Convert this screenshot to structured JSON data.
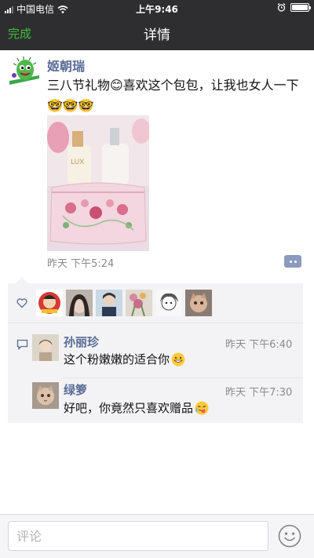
{
  "status_bar": {
    "carrier": "中国电信",
    "time": "上午9:46"
  },
  "nav": {
    "done_label": "完成",
    "title": "详情"
  },
  "post": {
    "author": "姬朝瑞",
    "text": "三八节礼物😊喜欢这个包包，让我也女人一下🤓🤓🤓",
    "time": "昨天  下午5:24"
  },
  "likes": {
    "avatars": [
      "liker-1",
      "liker-2",
      "liker-3",
      "liker-4",
      "liker-5",
      "liker-6"
    ]
  },
  "comments": [
    {
      "author": "孙丽珍",
      "time": "昨天  下午6:40",
      "text": "这个粉嫩嫩的适合你"
    },
    {
      "author": "绿箩",
      "time": "昨天  下午7:30",
      "text": "好吧，你竟然只喜欢赠品"
    }
  ],
  "input": {
    "placeholder": "评论"
  },
  "colors": {
    "bar_bg": "#2e2e30",
    "accent_green": "#3fbe3a",
    "name_blue": "#576b95",
    "panel_bg": "#f3f3f5"
  }
}
